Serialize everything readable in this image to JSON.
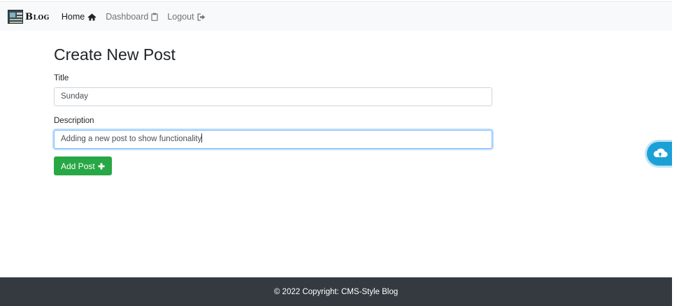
{
  "navbar": {
    "brand_text": "Blog",
    "links": [
      {
        "label": "Home",
        "icon": "home-icon",
        "active": true
      },
      {
        "label": "Dashboard",
        "icon": "clipboard-icon",
        "active": false
      },
      {
        "label": "Logout",
        "icon": "sign-out-icon",
        "active": false
      }
    ]
  },
  "main": {
    "title": "Create New Post",
    "title_field": {
      "label": "Title",
      "value": "Sunday"
    },
    "description_field": {
      "label": "Description",
      "value": "Adding a new post to show functionality"
    },
    "submit_label": "Add Post",
    "submit_icon": "plus-icon"
  },
  "floating_button": {
    "icon": "cloud-icon"
  },
  "footer": {
    "text": "© 2022 Copyright: CMS-Style Blog"
  },
  "colors": {
    "navbar_bg": "#f8f9fa",
    "success": "#28a745",
    "footer_bg": "#343a40",
    "focus_border": "#80bdff",
    "fab": "#1ba1d6"
  }
}
